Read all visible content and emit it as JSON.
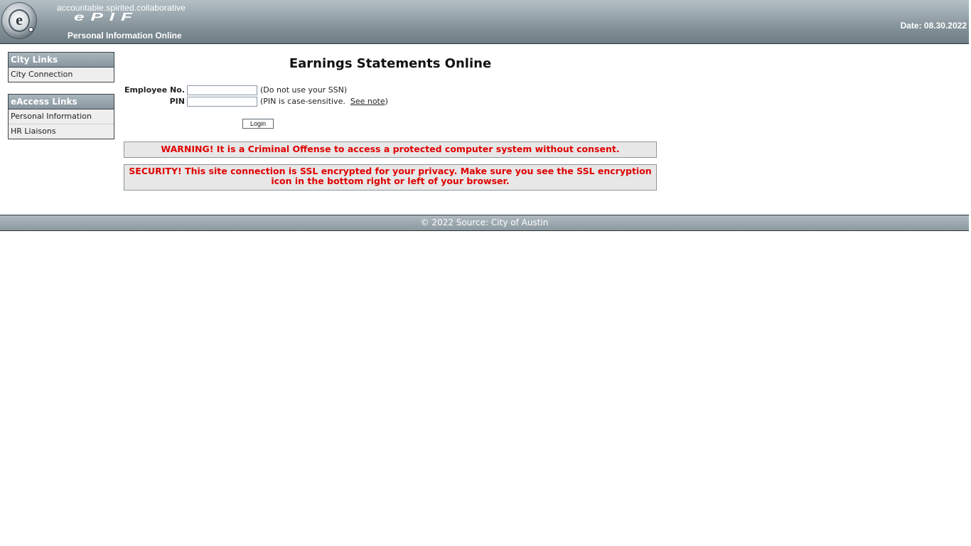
{
  "header": {
    "logo_letter": "e",
    "tagline": "accountable.spirited.collaborative",
    "brand": "ePIF",
    "subtitle": "Personal Information Online",
    "date_label": "Date: 08.30.2022",
    "colors": {
      "bar": "#8896a0",
      "text": "#ffffff"
    }
  },
  "sidebar": {
    "city_links": {
      "title": "City Links",
      "items": [
        {
          "label": "City Connection"
        }
      ]
    },
    "eaccess_links": {
      "title": "eAccess Links",
      "items": [
        {
          "label": "Personal Information"
        },
        {
          "label": "HR Liaisons"
        }
      ]
    }
  },
  "main": {
    "title": "Earnings Statements Online",
    "form": {
      "employee_label": "Employee No.",
      "employee_value": "",
      "employee_hint": "(Do not use your SSN)",
      "pin_label": "PIN",
      "pin_value": "",
      "pin_hint_prefix": "(PIN is case-sensitive.",
      "pin_hint_link": "See note",
      "pin_hint_suffix": ")",
      "login_label": "Login"
    },
    "warning": "WARNING! It is a Criminal Offense to access a protected computer system without consent.",
    "security": "SECURITY! This site connection is SSL encrypted for your privacy. Make sure you see the SSL encryption icon in the bottom right or left of your browser.",
    "notice_color": "#e00000"
  },
  "footer": {
    "text": "© 2022 Source: City of Austin"
  }
}
